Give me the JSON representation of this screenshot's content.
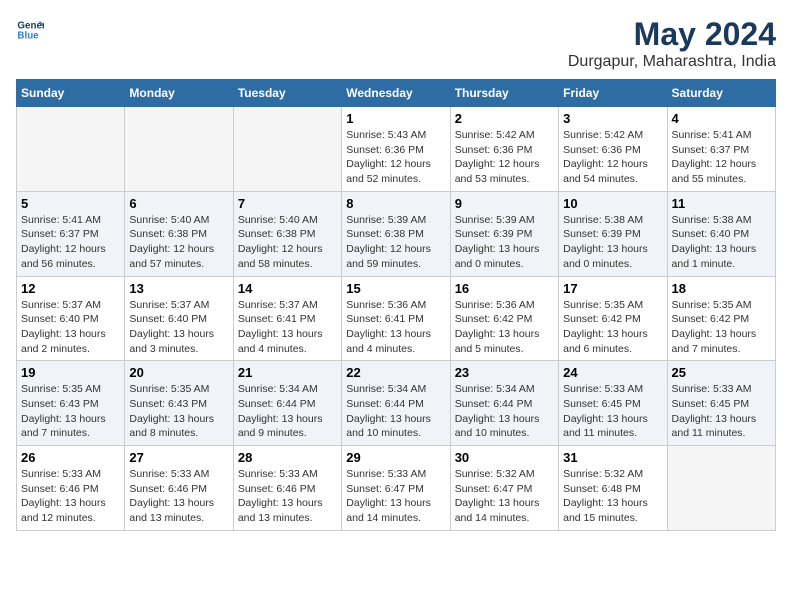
{
  "logo": {
    "line1": "General",
    "line2": "Blue"
  },
  "title": "May 2024",
  "location": "Durgapur, Maharashtra, India",
  "headers": [
    "Sunday",
    "Monday",
    "Tuesday",
    "Wednesday",
    "Thursday",
    "Friday",
    "Saturday"
  ],
  "weeks": [
    [
      {
        "day": "",
        "info": ""
      },
      {
        "day": "",
        "info": ""
      },
      {
        "day": "",
        "info": ""
      },
      {
        "day": "1",
        "info": "Sunrise: 5:43 AM\nSunset: 6:36 PM\nDaylight: 12 hours\nand 52 minutes."
      },
      {
        "day": "2",
        "info": "Sunrise: 5:42 AM\nSunset: 6:36 PM\nDaylight: 12 hours\nand 53 minutes."
      },
      {
        "day": "3",
        "info": "Sunrise: 5:42 AM\nSunset: 6:36 PM\nDaylight: 12 hours\nand 54 minutes."
      },
      {
        "day": "4",
        "info": "Sunrise: 5:41 AM\nSunset: 6:37 PM\nDaylight: 12 hours\nand 55 minutes."
      }
    ],
    [
      {
        "day": "5",
        "info": "Sunrise: 5:41 AM\nSunset: 6:37 PM\nDaylight: 12 hours\nand 56 minutes."
      },
      {
        "day": "6",
        "info": "Sunrise: 5:40 AM\nSunset: 6:38 PM\nDaylight: 12 hours\nand 57 minutes."
      },
      {
        "day": "7",
        "info": "Sunrise: 5:40 AM\nSunset: 6:38 PM\nDaylight: 12 hours\nand 58 minutes."
      },
      {
        "day": "8",
        "info": "Sunrise: 5:39 AM\nSunset: 6:38 PM\nDaylight: 12 hours\nand 59 minutes."
      },
      {
        "day": "9",
        "info": "Sunrise: 5:39 AM\nSunset: 6:39 PM\nDaylight: 13 hours\nand 0 minutes."
      },
      {
        "day": "10",
        "info": "Sunrise: 5:38 AM\nSunset: 6:39 PM\nDaylight: 13 hours\nand 0 minutes."
      },
      {
        "day": "11",
        "info": "Sunrise: 5:38 AM\nSunset: 6:40 PM\nDaylight: 13 hours\nand 1 minute."
      }
    ],
    [
      {
        "day": "12",
        "info": "Sunrise: 5:37 AM\nSunset: 6:40 PM\nDaylight: 13 hours\nand 2 minutes."
      },
      {
        "day": "13",
        "info": "Sunrise: 5:37 AM\nSunset: 6:40 PM\nDaylight: 13 hours\nand 3 minutes."
      },
      {
        "day": "14",
        "info": "Sunrise: 5:37 AM\nSunset: 6:41 PM\nDaylight: 13 hours\nand 4 minutes."
      },
      {
        "day": "15",
        "info": "Sunrise: 5:36 AM\nSunset: 6:41 PM\nDaylight: 13 hours\nand 4 minutes."
      },
      {
        "day": "16",
        "info": "Sunrise: 5:36 AM\nSunset: 6:42 PM\nDaylight: 13 hours\nand 5 minutes."
      },
      {
        "day": "17",
        "info": "Sunrise: 5:35 AM\nSunset: 6:42 PM\nDaylight: 13 hours\nand 6 minutes."
      },
      {
        "day": "18",
        "info": "Sunrise: 5:35 AM\nSunset: 6:42 PM\nDaylight: 13 hours\nand 7 minutes."
      }
    ],
    [
      {
        "day": "19",
        "info": "Sunrise: 5:35 AM\nSunset: 6:43 PM\nDaylight: 13 hours\nand 7 minutes."
      },
      {
        "day": "20",
        "info": "Sunrise: 5:35 AM\nSunset: 6:43 PM\nDaylight: 13 hours\nand 8 minutes."
      },
      {
        "day": "21",
        "info": "Sunrise: 5:34 AM\nSunset: 6:44 PM\nDaylight: 13 hours\nand 9 minutes."
      },
      {
        "day": "22",
        "info": "Sunrise: 5:34 AM\nSunset: 6:44 PM\nDaylight: 13 hours\nand 10 minutes."
      },
      {
        "day": "23",
        "info": "Sunrise: 5:34 AM\nSunset: 6:44 PM\nDaylight: 13 hours\nand 10 minutes."
      },
      {
        "day": "24",
        "info": "Sunrise: 5:33 AM\nSunset: 6:45 PM\nDaylight: 13 hours\nand 11 minutes."
      },
      {
        "day": "25",
        "info": "Sunrise: 5:33 AM\nSunset: 6:45 PM\nDaylight: 13 hours\nand 11 minutes."
      }
    ],
    [
      {
        "day": "26",
        "info": "Sunrise: 5:33 AM\nSunset: 6:46 PM\nDaylight: 13 hours\nand 12 minutes."
      },
      {
        "day": "27",
        "info": "Sunrise: 5:33 AM\nSunset: 6:46 PM\nDaylight: 13 hours\nand 13 minutes."
      },
      {
        "day": "28",
        "info": "Sunrise: 5:33 AM\nSunset: 6:46 PM\nDaylight: 13 hours\nand 13 minutes."
      },
      {
        "day": "29",
        "info": "Sunrise: 5:33 AM\nSunset: 6:47 PM\nDaylight: 13 hours\nand 14 minutes."
      },
      {
        "day": "30",
        "info": "Sunrise: 5:32 AM\nSunset: 6:47 PM\nDaylight: 13 hours\nand 14 minutes."
      },
      {
        "day": "31",
        "info": "Sunrise: 5:32 AM\nSunset: 6:48 PM\nDaylight: 13 hours\nand 15 minutes."
      },
      {
        "day": "",
        "info": ""
      }
    ]
  ]
}
